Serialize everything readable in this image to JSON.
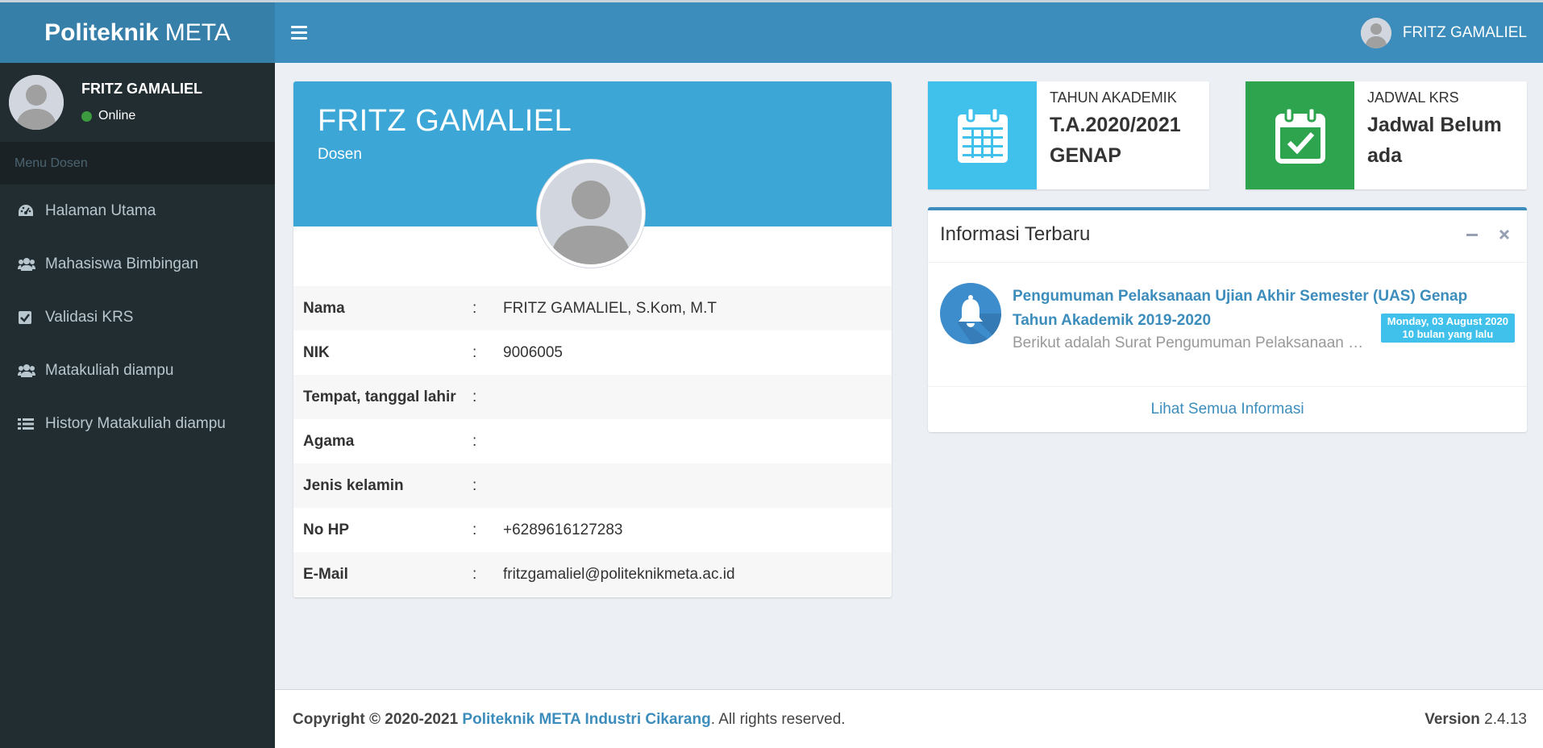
{
  "brand": {
    "bold": "Politeknik",
    "rest": "META"
  },
  "navbar": {
    "user_name": "FRITZ GAMALIEL"
  },
  "sidebar": {
    "user_name": "FRITZ GAMALIEL",
    "status": "Online",
    "menu_header": "Menu Dosen",
    "items": [
      {
        "label": "Halaman Utama",
        "icon": "dashboard-icon"
      },
      {
        "label": "Mahasiswa Bimbingan",
        "icon": "users-icon"
      },
      {
        "label": "Validasi KRS",
        "icon": "check-square-icon"
      },
      {
        "label": "Matakuliah diampu",
        "icon": "users-icon"
      },
      {
        "label": "History Matakuliah diampu",
        "icon": "list-icon"
      }
    ]
  },
  "profile": {
    "name": "FRITZ GAMALIEL",
    "role": "Dosen",
    "rows": [
      {
        "key": "Nama",
        "colon": ":",
        "value": "FRITZ GAMALIEL, S.Kom, M.T"
      },
      {
        "key": "NIK",
        "colon": ":",
        "value": "9006005"
      },
      {
        "key": "Tempat, tanggal lahir",
        "colon": ":",
        "value": ""
      },
      {
        "key": "Agama",
        "colon": ":",
        "value": ""
      },
      {
        "key": "Jenis kelamin",
        "colon": ":",
        "value": ""
      },
      {
        "key": "No HP",
        "colon": ":",
        "value": "+6289616127283"
      },
      {
        "key": "E-Mail",
        "colon": ":",
        "value": "fritzgamaliel@politeknikmeta.ac.id"
      }
    ]
  },
  "info_boxes": [
    {
      "label": "TAHUN AKADEMIK",
      "value_line1": "T.A.2020/2021",
      "value_line2": "GENAP",
      "color": "#3fc1ec",
      "icon": "calendar-icon"
    },
    {
      "label": "JADWAL KRS",
      "value_line1": "Jadwal Belum",
      "value_line2": "ada",
      "color": "#2ea44f",
      "icon": "calendar-check-icon"
    }
  ],
  "news": {
    "title": "Informasi Terbaru",
    "item": {
      "title": "Pengumuman Pelaksanaan Ujian Akhir Semester (UAS) Genap Tahun Akademik 2019-2020",
      "description": "Berikut adalah Surat Pengumuman Pelaksanaan Ujian Akhir Semester (UAS) Genap",
      "date": "Monday, 03 August 2020",
      "ago": "10 bulan yang lalu"
    },
    "footer_link": "Lihat Semua Informasi"
  },
  "footer": {
    "copyright": "Copyright © 2020-2021",
    "org": "Politeknik META Industri Cikarang",
    "rights": ". All rights reserved.",
    "version_label": "Version",
    "version": "2.4.13"
  },
  "colors": {
    "header": "#3c8dbc",
    "logo_bg": "#367fa9",
    "sidebar_bg": "#222d32",
    "profile_header": "#3ca7d6"
  }
}
